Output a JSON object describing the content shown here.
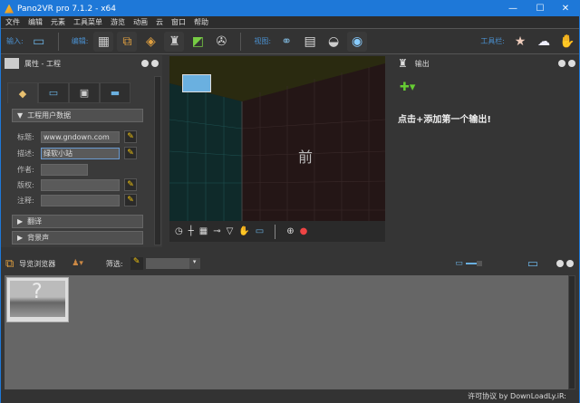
{
  "window": {
    "title": "Pano2VR pro 7.1.2 - x64",
    "minimize": "—",
    "maximize": "☐",
    "close": "✕"
  },
  "menu": [
    "文件",
    "编辑",
    "元素",
    "工具菜单",
    "游览",
    "动画",
    "云",
    "窗口",
    "帮助"
  ],
  "toolbar": {
    "input_label": "输入:",
    "edit_label": "编辑:",
    "view_label": "视图:",
    "toolbar_label": "工具栏:"
  },
  "properties": {
    "title": "属性 - 工程",
    "section_open": "工程用户数据",
    "fields": [
      {
        "label": "标题:",
        "value": "www.gndown.com"
      },
      {
        "label": "描述:",
        "value": "绿软小站"
      },
      {
        "label": "作者:",
        "value": ""
      },
      {
        "label": "版权:",
        "value": ""
      },
      {
        "label": "注释:",
        "value": ""
      }
    ],
    "sections_closed": [
      "翻译",
      "背景声"
    ]
  },
  "viewer": {
    "face_label": "前"
  },
  "output": {
    "title": "输出",
    "hint": "点击+添加第一个输出!"
  },
  "browser": {
    "title": "导览浏览器",
    "filter_label": "筛选:"
  },
  "status": {
    "text": "许可协议 by DownLoadLy.iR:"
  }
}
